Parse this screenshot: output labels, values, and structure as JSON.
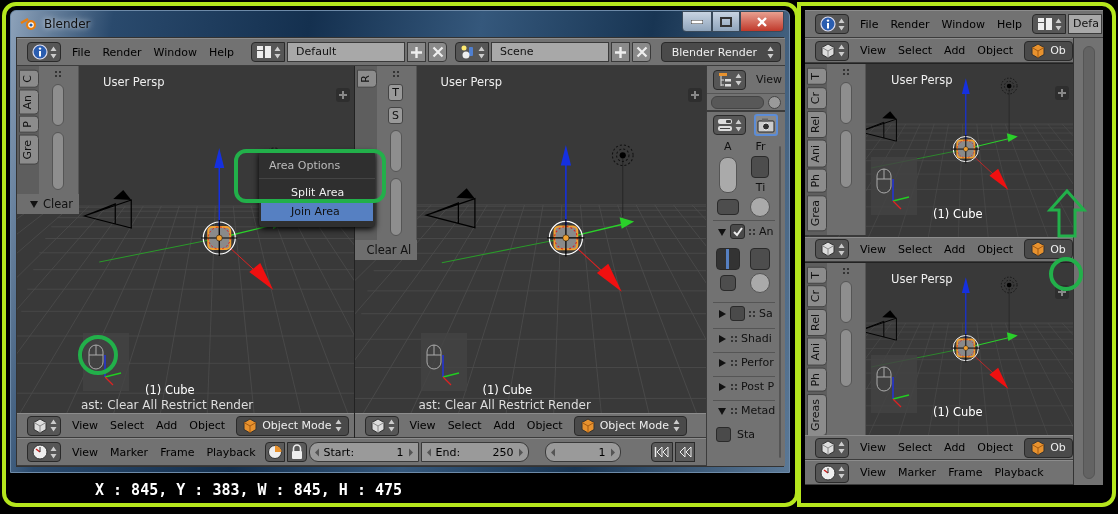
{
  "left_window": {
    "title": "Blender",
    "info_header": {
      "kind": "info",
      "menus": [
        "File",
        "Render",
        "Window",
        "Help"
      ],
      "layout": "Default",
      "scene": "Scene",
      "engine": "Blender Render"
    },
    "viewports": [
      {
        "tabs": [
          "C",
          "An",
          "P",
          "Gre"
        ],
        "panel": {
          "label": "Clear",
          "expanded": true
        },
        "label": "User Persp",
        "object_label": "(1) Cube",
        "last_operator": "ast: Clear All Restrict Render",
        "header": {
          "kind": "view3d",
          "menus": [
            "View",
            "Select",
            "Add",
            "Object"
          ],
          "mode": "Object Mode"
        }
      },
      {
        "tabs": [
          "R"
        ],
        "shelf_buttons": [
          "T",
          "S"
        ],
        "panel": {
          "label": "Clear Al"
        },
        "label": "User Persp",
        "object_label": "(1) Cube",
        "last_operator": "ast: Clear All Restrict Render",
        "header": {
          "kind": "view3d",
          "menus": [
            "View",
            "Select",
            "Add",
            "Object"
          ],
          "mode": "Object Mode"
        }
      }
    ],
    "context_menu": {
      "title": "Area Options",
      "items": [
        {
          "label": "Split Area",
          "selected": false
        },
        {
          "label": "Join Area",
          "selected": true
        }
      ]
    },
    "timeline": {
      "kind": "timeline",
      "menus": [
        "View",
        "Marker",
        "Frame",
        "Playback"
      ],
      "start": {
        "label": "Start:",
        "value": "1"
      },
      "end": {
        "label": "End:",
        "value": "250"
      },
      "current": {
        "value": "1"
      }
    },
    "properties": {
      "outliner_menu": "View",
      "labels": [
        "A",
        "Fr",
        "Ti"
      ],
      "sections": [
        {
          "label": "An",
          "expanded": true,
          "kind": "toggle",
          "checked": true
        },
        {
          "label": "Sa",
          "expanded": false,
          "kind": "toggle",
          "checked": false
        },
        {
          "label": "Shadi",
          "expanded": false,
          "kind": "plain"
        },
        {
          "label": "Perfor",
          "expanded": false,
          "kind": "plain"
        },
        {
          "label": "Post P",
          "expanded": false,
          "kind": "plain"
        },
        {
          "label": "Metad",
          "expanded": true,
          "kind": "plain",
          "options": [
            {
              "label": "Sta",
              "checked": false
            }
          ]
        }
      ]
    }
  },
  "coordinates_caption": "X : 845, Y : 383, W : 845, H : 475",
  "right_window": {
    "info_header": {
      "kind": "info",
      "menus": [
        "File",
        "Render",
        "Window",
        "Help"
      ],
      "layout": "Defa"
    },
    "areas": [
      {
        "kind": "view3d",
        "menus": [
          "View",
          "Select",
          "Add",
          "Object"
        ],
        "mode": "Ob"
      },
      {
        "kind": "viewport",
        "tabs": [
          "T",
          "Cr",
          "Rel",
          "Ani",
          "Ph",
          "Grea"
        ],
        "label": "User Persp",
        "object_label": "(1) Cube"
      },
      {
        "kind": "view3d",
        "menus": [
          "View",
          "Select",
          "Add",
          "Object"
        ],
        "mode": "Ob"
      },
      {
        "kind": "viewport",
        "tabs": [
          "T",
          "Cr",
          "Rel",
          "Ani",
          "Ph",
          "Greas"
        ],
        "label": "User Persp",
        "object_label": "(1) Cube"
      },
      {
        "kind": "view3d",
        "menus": [
          "View",
          "Select",
          "Add",
          "Object"
        ],
        "mode": "Ob"
      },
      {
        "kind": "timeline",
        "menus": [
          "View",
          "Marker",
          "Frame",
          "Playback"
        ]
      }
    ]
  }
}
